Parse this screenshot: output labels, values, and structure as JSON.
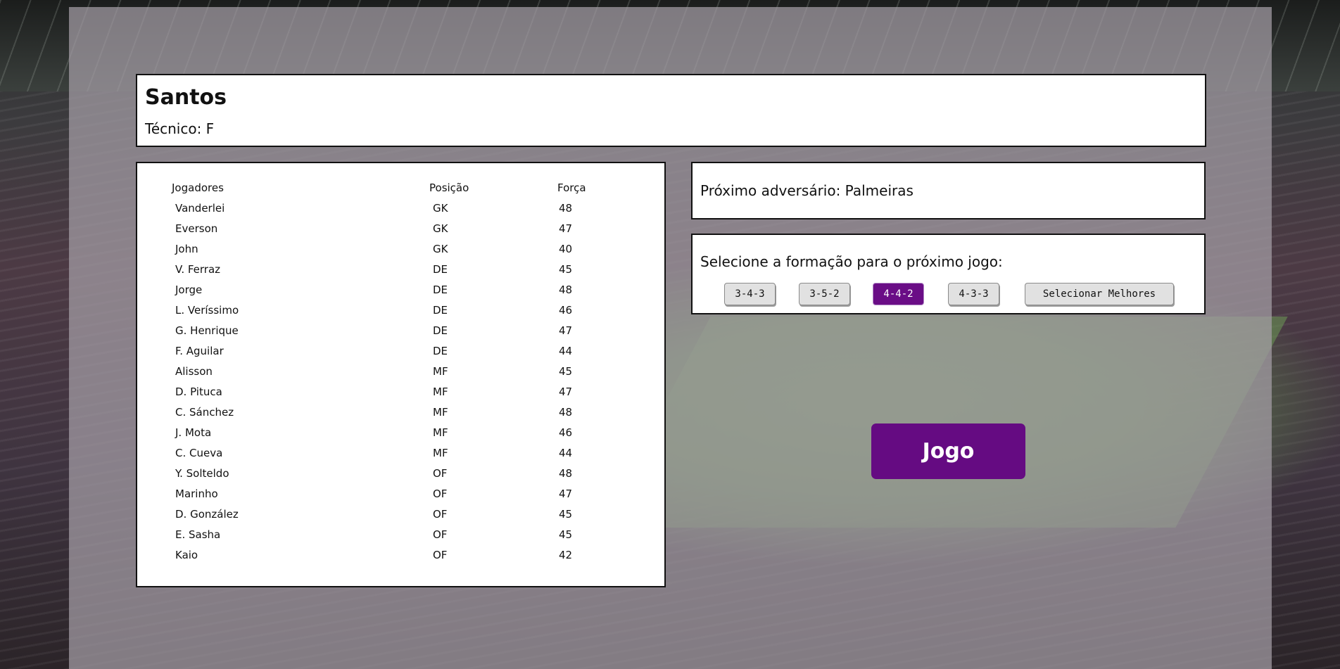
{
  "team": {
    "name": "Santos",
    "coach": "Técnico: F"
  },
  "roster": {
    "headers": {
      "player": "Jogadores",
      "position": "Posição",
      "strength": "Força"
    },
    "players": [
      {
        "name": "Vanderlei",
        "pos": "GK",
        "str": "48"
      },
      {
        "name": "Everson",
        "pos": "GK",
        "str": "47"
      },
      {
        "name": "John",
        "pos": "GK",
        "str": "40"
      },
      {
        "name": "V. Ferraz",
        "pos": "DE",
        "str": "45"
      },
      {
        "name": "Jorge",
        "pos": "DE",
        "str": "48"
      },
      {
        "name": "L. Veríssimo",
        "pos": "DE",
        "str": "46"
      },
      {
        "name": "G. Henrique",
        "pos": "DE",
        "str": "47"
      },
      {
        "name": "F. Aguilar",
        "pos": "DE",
        "str": "44"
      },
      {
        "name": "Alisson",
        "pos": "MF",
        "str": "45"
      },
      {
        "name": "D. Pituca",
        "pos": "MF",
        "str": "47"
      },
      {
        "name": "C. Sánchez",
        "pos": "MF",
        "str": "48"
      },
      {
        "name": "J. Mota",
        "pos": "MF",
        "str": "46"
      },
      {
        "name": "C. Cueva",
        "pos": "MF",
        "str": "44"
      },
      {
        "name": "Y. Solteldo",
        "pos": "OF",
        "str": "48"
      },
      {
        "name": "Marinho",
        "pos": "OF",
        "str": "47"
      },
      {
        "name": "D. González",
        "pos": "OF",
        "str": "45"
      },
      {
        "name": "E. Sasha",
        "pos": "OF",
        "str": "45"
      },
      {
        "name": "Kaio",
        "pos": "OF",
        "str": "42"
      }
    ]
  },
  "opponent": {
    "text": "Próximo adversário: Palmeiras"
  },
  "formation": {
    "prompt": "Selecione a formação para o próximo jogo:",
    "options": [
      "3-4-3",
      "3-5-2",
      "4-4-2",
      "4-3-3",
      "Selecionar Melhores"
    ],
    "selected": "4-4-2"
  },
  "actions": {
    "play_label": "Jogo"
  },
  "colors": {
    "accent": "#650b82",
    "overlay": "#a59ea6"
  }
}
